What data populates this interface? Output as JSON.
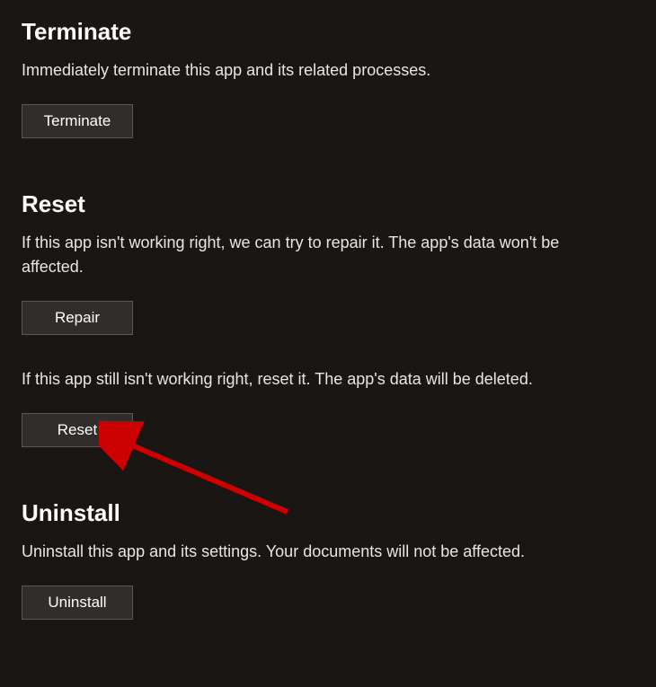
{
  "terminate": {
    "heading": "Terminate",
    "description": "Immediately terminate this app and its related processes.",
    "button_label": "Terminate"
  },
  "reset": {
    "heading": "Reset",
    "repair_description": "If this app isn't working right, we can try to repair it. The app's data won't be affected.",
    "repair_button_label": "Repair",
    "reset_description": "If this app still isn't working right, reset it. The app's data will be deleted.",
    "reset_button_label": "Reset"
  },
  "uninstall": {
    "heading": "Uninstall",
    "description": "Uninstall this app and its settings. Your documents will not be affected.",
    "button_label": "Uninstall"
  },
  "annotation": {
    "arrow_color": "#cc0000"
  }
}
